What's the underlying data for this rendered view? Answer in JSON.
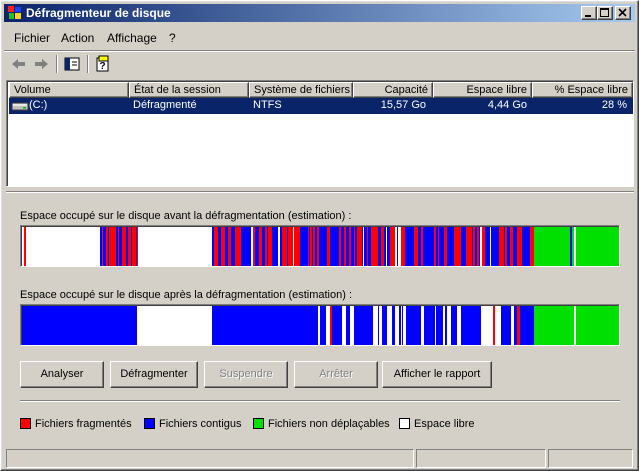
{
  "window": {
    "title": "Défragmenteur de disque",
    "icon": "defrag-app-icon"
  },
  "menu": {
    "items": [
      "Fichier",
      "Action",
      "Affichage",
      "?"
    ]
  },
  "toolbar": {
    "icons": [
      "back-arrow-icon",
      "forward-arrow-icon",
      "show-hide-console-tree-icon",
      "help-icon"
    ]
  },
  "listview": {
    "columns": [
      "Volume",
      "État de la session",
      "Système de fichiers",
      "Capacité",
      "Espace libre",
      "% Espace libre"
    ],
    "rows": [
      {
        "volume": "(C:)",
        "state": "Défragmenté",
        "fs": "NTFS",
        "capacity": "15,57 Go",
        "free": "4,44 Go",
        "free_pct": "28 %"
      }
    ]
  },
  "maps": {
    "before_label": "Espace occupé sur le disque avant la défragmentation (estimation) :",
    "after_label": "Espace occupé sur le disque après la défragmentation (estimation) :"
  },
  "buttons": {
    "analyze": "Analyser",
    "defragment": "Défragmenter",
    "pause": "Suspendre",
    "stop": "Arrêter",
    "report": "Afficher le rapport"
  },
  "legend": {
    "fragmented": "Fichiers fragmentés",
    "contiguous": "Fichiers contigus",
    "unmovable": "Fichiers non déplaçables",
    "free": "Espace libre"
  },
  "colors": {
    "fragmented": "#ff0000",
    "contiguous": "#0000ff",
    "unmovable": "#00e000",
    "free": "#ffffff",
    "selection": "#0a246a"
  }
}
